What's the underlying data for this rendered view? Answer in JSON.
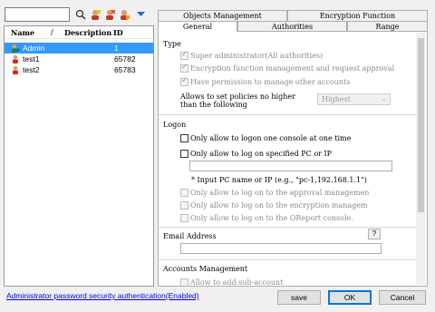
{
  "search": {
    "value": ""
  },
  "toolbar": {
    "icons": [
      "search-icon",
      "user-add-icon",
      "user-remove-icon",
      "user-settings-icon",
      "dropdown-arrow-icon"
    ]
  },
  "user_list": {
    "columns": [
      "Name",
      "/",
      "Description",
      "ID"
    ],
    "rows": [
      {
        "name": "Admin",
        "description": "",
        "id": "1",
        "selected": true
      },
      {
        "name": "test1",
        "description": "",
        "id": "65782",
        "selected": false
      },
      {
        "name": "test2",
        "description": "",
        "id": "65783",
        "selected": false
      }
    ]
  },
  "tabs": {
    "top_row": [
      "Objects Management",
      "Encryption Function"
    ],
    "bottom_row": [
      "General",
      "Authorities",
      "Range"
    ],
    "active": "General"
  },
  "type_section": {
    "title": "Type",
    "options": [
      {
        "label": "Super administrator(All authorities)",
        "checked": true,
        "disabled": true
      },
      {
        "label": "Encryption function management and request approval",
        "checked": true,
        "disabled": true
      },
      {
        "label": "Have permission to manage other accounts",
        "checked": true,
        "disabled": true
      }
    ],
    "policy_label_line1": "Allows to set policies no higher",
    "policy_label_line2": "than the following",
    "policy_value": "Highest"
  },
  "logon_section": {
    "title": "Logon",
    "options": [
      {
        "label": "Only allow to logon one console at one time",
        "checked": false,
        "disabled": false
      },
      {
        "label": "Only allow to log on specified PC or IP",
        "checked": false,
        "disabled": false
      }
    ],
    "ip_value": "",
    "ip_hint": "* Input PC name or IP (e.g., \"pc-1,192.168.1.1\")",
    "disabled_options": [
      "Only allow to log on to the approval managemen",
      "Only allow to log on to the encryption managem",
      "Only allow to log on to the OReport console."
    ]
  },
  "email_section": {
    "title": "Email Address",
    "help": "?",
    "value": ""
  },
  "accounts_section": {
    "title": "Accounts Management",
    "partial_option": "Allow to add sub-account"
  },
  "footer": {
    "link": "Administrator password security authentication(Enabled)",
    "save": "save",
    "ok": "OK",
    "cancel": "Cancel"
  }
}
